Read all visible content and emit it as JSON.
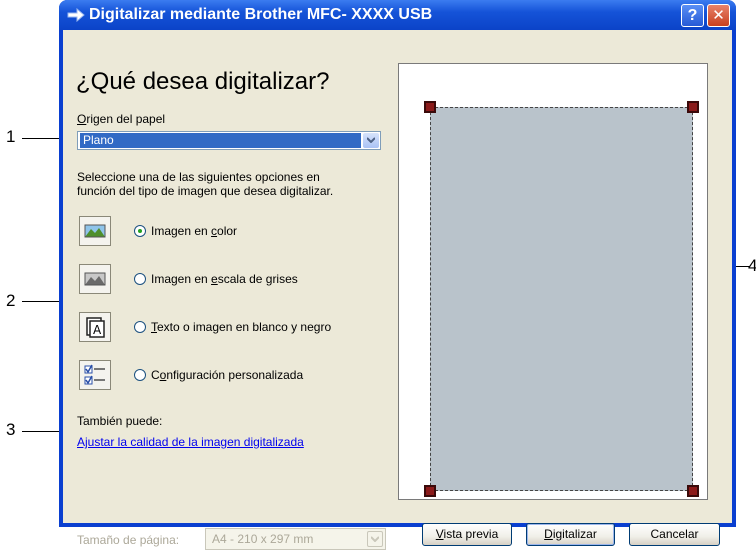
{
  "callouts": [
    "1",
    "2",
    "3",
    "4"
  ],
  "window": {
    "title": "Digitalizar mediante Brother MFC- XXXX USB",
    "help_label": "?",
    "close_label": "✕"
  },
  "heading": "¿Qué desea digitalizar?",
  "paper_source": {
    "label_first": "O",
    "label_rest": "rigen del papel",
    "value": "Plano"
  },
  "instructions": {
    "line1": "Seleccione una de las siguientes opciones en",
    "line2": "función del tipo de imagen que desea digitalizar."
  },
  "options": [
    {
      "pre": "Imagen en ",
      "key": "c",
      "post": "olor",
      "icon": "color-image-icon",
      "selected": true
    },
    {
      "pre": "Imagen en ",
      "key": "e",
      "post": "scala de grises",
      "icon": "grayscale-image-icon",
      "selected": false
    },
    {
      "pre": "",
      "key": "T",
      "post": "exto o imagen en blanco y negro",
      "icon": "black-white-text-icon",
      "selected": false
    },
    {
      "pre": "C",
      "key": "o",
      "post": "nfiguración personalizada",
      "icon": "custom-settings-icon",
      "selected": false
    }
  ],
  "also": {
    "label": "También puede:",
    "link": "Ajustar la calidad de la imagen digitalizada"
  },
  "page_size": {
    "label": "Tamaño de página:",
    "value": "A4 - 210 x 297 mm"
  },
  "buttons": {
    "preview": {
      "key": "V",
      "rest": "ista previa"
    },
    "scan": {
      "key": "D",
      "rest": "igitalizar"
    },
    "cancel": "Cancelar"
  },
  "colors": {
    "titlebar": "#0b43c8",
    "dialog_bg": "#ece9d8",
    "selection": "#316ac5",
    "preview_area": "#b9c3cb",
    "handle": "#8b1a1a",
    "link": "#0000ee"
  }
}
